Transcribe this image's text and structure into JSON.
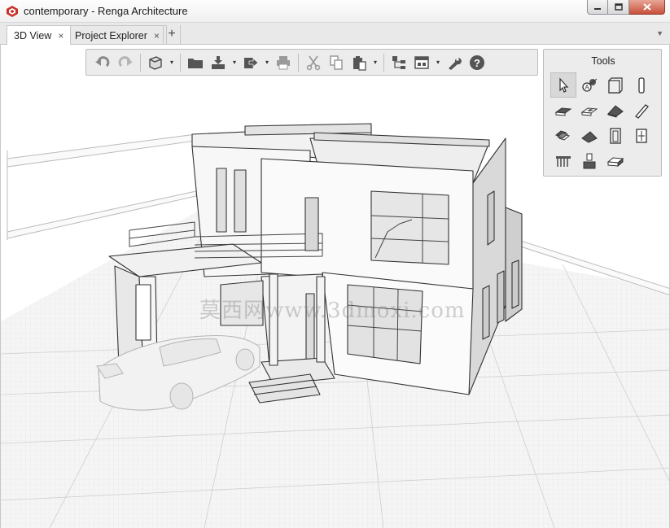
{
  "window": {
    "title": "contemporary - Renga Architecture",
    "app_icon": "renga-logo-icon",
    "controls": [
      "minimize-icon",
      "maximize-icon",
      "close-icon"
    ]
  },
  "tabs": [
    {
      "label": "3D View",
      "close": "×",
      "active": true
    },
    {
      "label": "Project Explorer",
      "close": "×",
      "active": false
    }
  ],
  "tab_add": "+",
  "tab_menu": "▼",
  "toolbar": {
    "buttons": [
      "undo-icon",
      "redo-icon",
      "view-cube-icon",
      "open-folder-icon",
      "import-icon",
      "export-icon",
      "print-icon",
      "cut-icon",
      "copy-icon",
      "paste-icon",
      "structure-icon",
      "view-settings-icon",
      "settings-wrench-icon",
      "help-icon"
    ],
    "dropdown_glyph": "▾"
  },
  "tools_panel": {
    "title": "Tools",
    "items": [
      "select-icon",
      "axis-icon",
      "wall-icon",
      "column-icon",
      "floor-slab-icon",
      "opening-icon",
      "roof-icon",
      "beam-icon",
      "stair-icon",
      "ramp-icon",
      "door-icon",
      "window-icon",
      "railing-icon",
      "element-icon",
      "isolated-foundation-icon"
    ],
    "selected": "select-icon"
  },
  "watermark": "莫西网www.3dmoxi.com",
  "colors": {
    "accent_close": "#c7503a",
    "toolbar_bg": "#ececec",
    "grid_line": "#cfcfcf"
  }
}
